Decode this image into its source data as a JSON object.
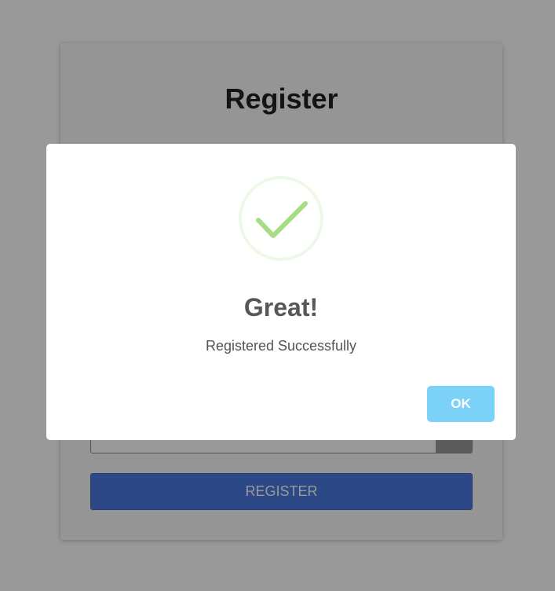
{
  "register": {
    "title": "Register",
    "password_value": "",
    "submit_label": "REGISTER"
  },
  "modal": {
    "icon": "success-check-icon",
    "title": "Great!",
    "text": "Registered Successfully",
    "ok_label": "OK"
  },
  "colors": {
    "register_button": "#4a78e0",
    "ok_button": "#7cd1f9",
    "check_stroke": "#a5dc86",
    "check_ring": "#eef8e8",
    "overlay": "rgba(0,0,0,0.4)"
  }
}
